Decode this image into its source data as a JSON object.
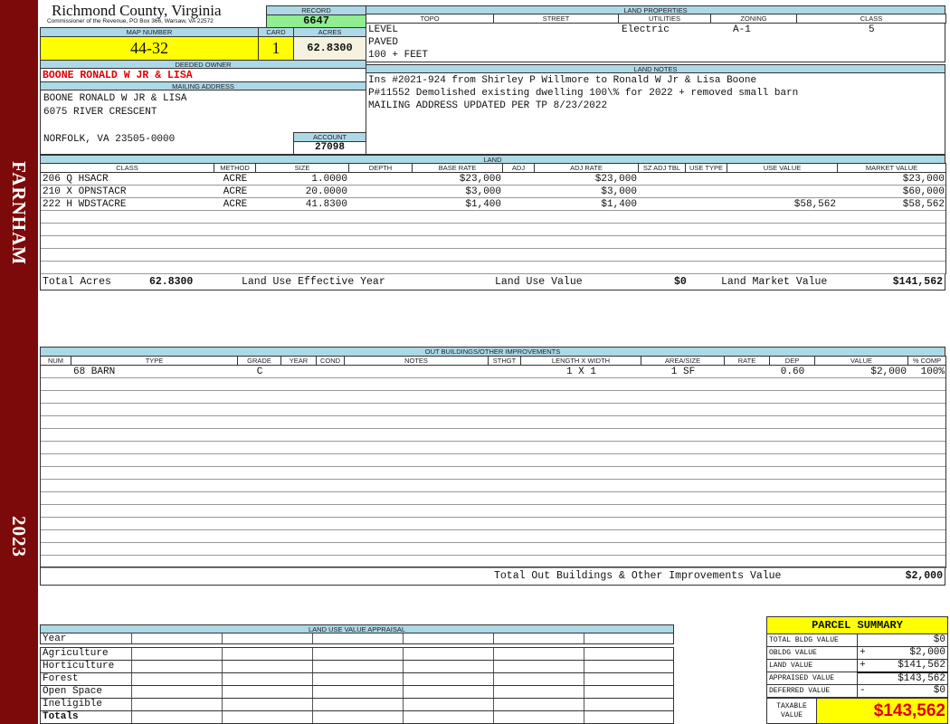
{
  "sidebar": {
    "district": "FARNHAM",
    "year": "2023"
  },
  "header": {
    "title": "Richmond County, Virginia",
    "subtitle": "Commissioner of the Revenue, PO Box 366, Warsaw, VA 22572"
  },
  "record": {
    "label": "RECORD",
    "value": "6647"
  },
  "map": {
    "label": "MAP NUMBER",
    "value": "44-32"
  },
  "card": {
    "label": "CARD",
    "value": "1"
  },
  "acres": {
    "label": "ACRES",
    "value": "62.8300"
  },
  "owner": {
    "label": "DEEDED OWNER",
    "value": "BOONE RONALD W JR & LISA"
  },
  "mailing": {
    "label": "MAILING ADDRESS",
    "lines": [
      "BOONE RONALD W JR & LISA",
      "6075 RIVER CRESCENT",
      "",
      "NORFOLK, VA 23505-0000"
    ]
  },
  "account": {
    "label": "ACCOUNT",
    "value": "27098"
  },
  "land_properties": {
    "label": "LAND PROPERTIES",
    "columns": [
      "TOPO",
      "STREET",
      "UTILITIES",
      "ZONING",
      "CLASS"
    ],
    "topo": [
      "LEVEL",
      "PAVED",
      "100 + FEET"
    ],
    "utilities": "Electric",
    "zoning": "A-1",
    "class": "5"
  },
  "land_notes": {
    "label": "LAND NOTES",
    "lines": [
      "Ins #2021-924 from Shirley P Willmore to Ronald W Jr & Lisa Boone",
      "P#11552 Demolished existing dwelling 100\\% for 2022 + removed small barn",
      "MAILING ADDRESS UPDATED PER TP 8/23/2022"
    ]
  },
  "land": {
    "label": "LAND",
    "columns": [
      "CLASS",
      "METHOD",
      "SIZE",
      "DEPTH",
      "BASE RATE",
      "ADJ",
      "ADJ RATE",
      "SZ ADJ TBL",
      "USE TYPE",
      "USE VALUE",
      "MARKET VALUE"
    ],
    "rows": [
      [
        "206 Q HSACR",
        "ACRE",
        "1.0000",
        "",
        "$23,000",
        "",
        "$23,000",
        "",
        "",
        "",
        "$23,000"
      ],
      [
        "210 X OPNSTACR",
        "ACRE",
        "20.0000",
        "",
        "$3,000",
        "",
        "$3,000",
        "",
        "",
        "",
        "$60,000"
      ],
      [
        "222 H WDSTACRE",
        "ACRE",
        "41.8300",
        "",
        "$1,400",
        "",
        "$1,400",
        "",
        "",
        "$58,562",
        "$58,562"
      ]
    ],
    "totals": {
      "acres_label": "Total Acres",
      "acres": "62.8300",
      "effective_year_label": "Land Use Effective Year",
      "use_value_label": "Land Use Value",
      "use_value": "$0",
      "market_label": "Land Market Value",
      "market": "$141,562"
    }
  },
  "outbuildings": {
    "label": "OUT BUILDINGS/OTHER IMPROVEMENTS",
    "columns": [
      "NUM",
      "TYPE",
      "GRADE",
      "YEAR",
      "COND",
      "NOTES",
      "STHGT",
      "LENGTH X WIDTH",
      "AREA/SIZE",
      "RATE",
      "DEP",
      "VALUE",
      "% COMP"
    ],
    "rows": [
      [
        "",
        "68 BARN",
        "C",
        "",
        "",
        "",
        "",
        "1 X 1",
        "1 SF",
        "",
        "0.60",
        "$2,000",
        "100%"
      ]
    ],
    "total_label": "Total Out Buildings & Other Improvements Value",
    "total": "$2,000"
  },
  "land_use_appraisal": {
    "label": "LAND USE VALUE APPRAISAL",
    "rows": [
      "Year",
      "Agriculture",
      "Horticulture",
      "Forest",
      "Open Space",
      "Ineligible",
      "Totals"
    ]
  },
  "parcel_summary": {
    "title": "PARCEL SUMMARY",
    "rows": [
      {
        "label": "TOTAL BLDG VALUE",
        "sign": "",
        "value": "$0"
      },
      {
        "label": "OBLDG VALUE",
        "sign": "+",
        "value": "$2,000"
      },
      {
        "label": "LAND VALUE",
        "sign": "+",
        "value": "$141,562"
      },
      {
        "label": "APPRAISED VALUE",
        "sign": "",
        "value": "$143,562"
      },
      {
        "label": "DEFERRED VALUE",
        "sign": "-",
        "value": "$0"
      }
    ],
    "taxable_label": "TAXABLE VALUE",
    "taxable": "$143,562"
  },
  "colors": {
    "sidebar": "#7d0a0a",
    "label_bg": "#add8e6",
    "highlight": "#ffff00",
    "record_bg": "#90ee90",
    "owner_text": "#e00000"
  }
}
